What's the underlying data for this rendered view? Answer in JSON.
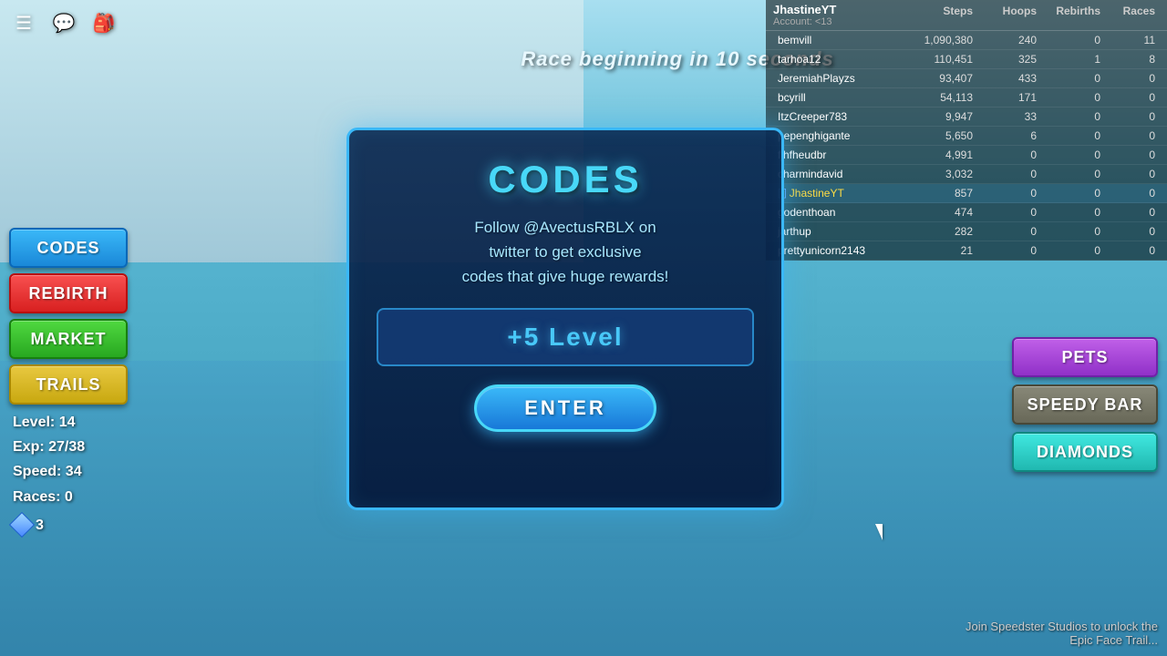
{
  "background": {
    "color_top": "#a8dff0",
    "color_bottom": "#3a98b4"
  },
  "topbar": {
    "icons": [
      "☰",
      "💬",
      "🎒"
    ]
  },
  "race_banner": {
    "text": "Race beginning in 10 seconds"
  },
  "left_sidebar": {
    "buttons": [
      {
        "id": "codes",
        "label": "CODES",
        "style": "codes"
      },
      {
        "id": "rebirth",
        "label": "REBIRTH",
        "style": "rebirth"
      },
      {
        "id": "market",
        "label": "MARKET",
        "style": "market"
      },
      {
        "id": "trails",
        "label": "TRAILS",
        "style": "trails"
      }
    ]
  },
  "stats": {
    "level": "Level: 14",
    "exp": "Exp: 27/38",
    "speed": "Speed: 34",
    "races": "Races: 0",
    "diamonds": "3"
  },
  "modal": {
    "title": "CODES",
    "description": "Follow @AvectusRBLX on\ntwitter to get exclusive\ncodes that give huge rewards!",
    "reward_text": "+5 Level",
    "enter_label": "ENTER"
  },
  "leaderboard": {
    "current_user": {
      "name": "JhastineYT",
      "account": "Account: <13"
    },
    "columns": [
      "Steps",
      "Hoops",
      "Rebirths",
      "Races"
    ],
    "current_user_stats": [
      "857",
      "0",
      "0",
      "0"
    ],
    "rows": [
      {
        "name": "bemvill",
        "steps": "1,090,380",
        "hoops": "240",
        "rebirths": "0",
        "races": "11",
        "highlight": false
      },
      {
        "name": "tarhoa12",
        "steps": "110,451",
        "hoops": "325",
        "rebirths": "1",
        "races": "8",
        "highlight": false
      },
      {
        "name": "JeremiahPlayzs",
        "steps": "93,407",
        "hoops": "433",
        "rebirths": "0",
        "races": "0",
        "highlight": false
      },
      {
        "name": "bcyrill",
        "steps": "54,113",
        "hoops": "171",
        "rebirths": "0",
        "races": "0",
        "highlight": false
      },
      {
        "name": "ItzCreeper783",
        "steps": "9,947",
        "hoops": "33",
        "rebirths": "0",
        "races": "0",
        "highlight": false
      },
      {
        "name": "pepenghigante",
        "steps": "5,650",
        "hoops": "6",
        "rebirths": "0",
        "races": "0",
        "highlight": false
      },
      {
        "name": "fjhfheudbr",
        "steps": "4,991",
        "hoops": "0",
        "rebirths": "0",
        "races": "0",
        "highlight": false
      },
      {
        "name": "charmindavid",
        "steps": "3,032",
        "hoops": "0",
        "rebirths": "0",
        "races": "0",
        "highlight": false
      },
      {
        "name": "JhastineYT",
        "steps": "857",
        "hoops": "0",
        "rebirths": "0",
        "races": "0",
        "highlight": true,
        "indicator": "[-]"
      },
      {
        "name": "godenthoan",
        "steps": "474",
        "hoops": "0",
        "rebirths": "0",
        "races": "0",
        "highlight": false
      },
      {
        "name": "jarthup",
        "steps": "282",
        "hoops": "0",
        "rebirths": "0",
        "races": "0",
        "highlight": false
      },
      {
        "name": "prettyunicorn2143",
        "steps": "21",
        "hoops": "0",
        "rebirths": "0",
        "races": "0",
        "highlight": false
      }
    ]
  },
  "right_sidebar": {
    "buttons": [
      {
        "id": "pets",
        "label": "PETS",
        "style": "pets"
      },
      {
        "id": "speedy",
        "label": "SPEEDY BAR",
        "style": "speedy"
      },
      {
        "id": "diamonds",
        "label": "DIAMONDS",
        "style": "diamonds"
      }
    ]
  },
  "bottom_right": {
    "line1": "Join Speedster Studios to unlock the",
    "line2": "Epic Face Trail..."
  }
}
